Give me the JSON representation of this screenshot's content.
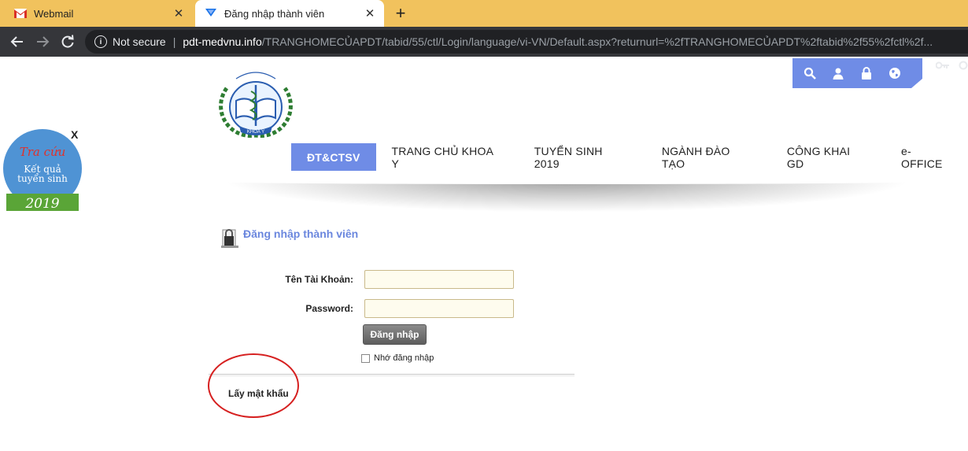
{
  "browser": {
    "tabs": [
      {
        "title": "Webmail",
        "favicon": "gmail-icon"
      },
      {
        "title": "Đăng nhập thành viên",
        "favicon": "site-icon"
      }
    ],
    "security_label": "Not secure",
    "url_domain": "pdt-medvnu.info",
    "url_path": "/TRANGHOMECỦAPDT/tabid/55/ctl/Login/language/vi-VN/Default.aspx?returnurl=%2fTRANGHOMECỦAPDT%2ftabid%2f55%2fctl%2f..."
  },
  "header": {
    "logo_text": "KHOA Y",
    "top_icons": [
      "search-icon",
      "user-icon",
      "lock-icon",
      "globe-icon"
    ]
  },
  "menu": {
    "items": [
      "ĐT&CTSV",
      "TRANG CHỦ KHOA Y",
      "TUYỂN SINH 2019",
      "NGÀNH ĐÀO TẠO",
      "CÔNG KHAI GD",
      "e-OFFICE"
    ],
    "active_index": 0,
    "accent_color": "#6f8ce6"
  },
  "promo": {
    "line1": "Tra cứu",
    "line2": "Kết quả",
    "line3": "tuyển sinh",
    "year": "2019",
    "close_label": "X"
  },
  "login": {
    "title": "Đăng nhập thành viên",
    "username_label": "Tên Tài Khoản:",
    "username_value": "",
    "password_label": "Password:",
    "password_value": "",
    "submit_label": "Đăng nhập",
    "remember_label": "Nhớ đăng nhập",
    "remember_checked": false,
    "forgot_password_label": "Lấy mật khẩu"
  }
}
